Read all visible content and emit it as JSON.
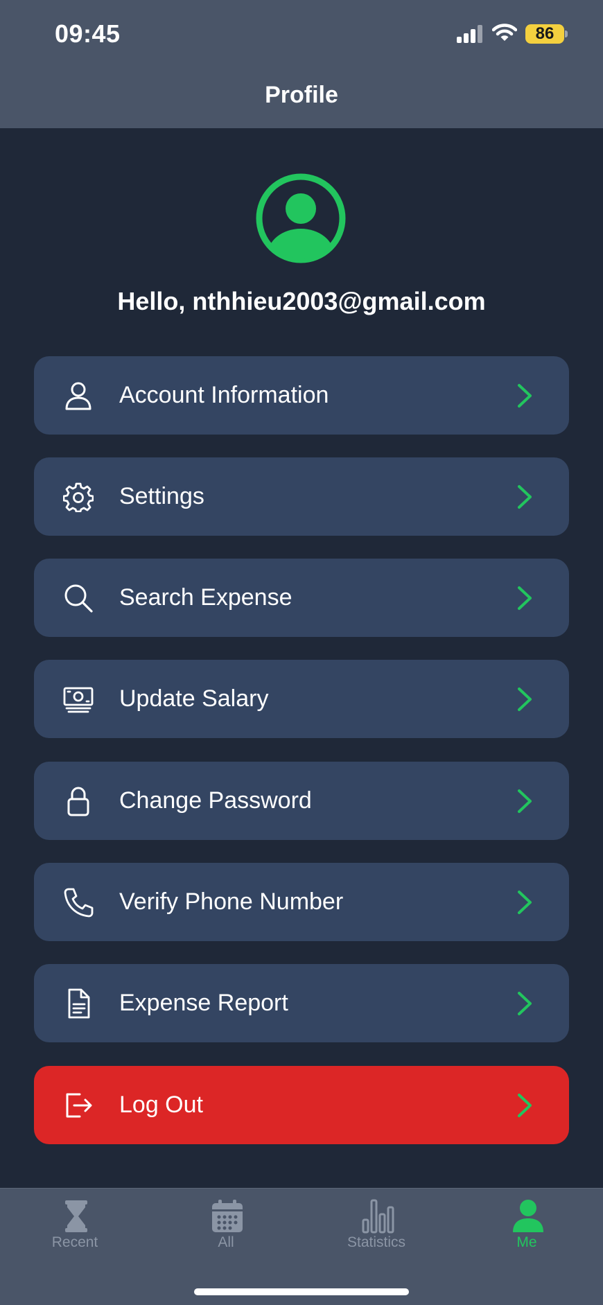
{
  "status_bar": {
    "time": "09:45",
    "battery_level": "86"
  },
  "header": {
    "title": "Profile"
  },
  "profile": {
    "greeting": "Hello, nthhieu2003@gmail.com",
    "avatar_icon": "user-circle-icon"
  },
  "menu": {
    "items": [
      {
        "label": "Account Information",
        "icon": "user-icon"
      },
      {
        "label": "Settings",
        "icon": "gear-icon"
      },
      {
        "label": "Search Expense",
        "icon": "search-icon"
      },
      {
        "label": "Update Salary",
        "icon": "money-icon"
      },
      {
        "label": "Change Password",
        "icon": "lock-icon"
      },
      {
        "label": "Verify Phone Number",
        "icon": "phone-icon"
      },
      {
        "label": "Expense Report",
        "icon": "document-icon"
      }
    ],
    "logout": {
      "label": "Log Out",
      "icon": "logout-icon"
    }
  },
  "tabbar": {
    "tabs": [
      {
        "label": "Recent",
        "icon": "hourglass-icon"
      },
      {
        "label": "All",
        "icon": "calendar-icon"
      },
      {
        "label": "Statistics",
        "icon": "bar-chart-icon"
      },
      {
        "label": "Me",
        "icon": "person-icon"
      }
    ],
    "active": "Me"
  },
  "colors": {
    "accent": "#22c55e",
    "background": "#1f2838",
    "card": "#344562",
    "danger": "#dc2626",
    "bar": "#4a5568",
    "inactive_tab": "#8b95a5"
  }
}
